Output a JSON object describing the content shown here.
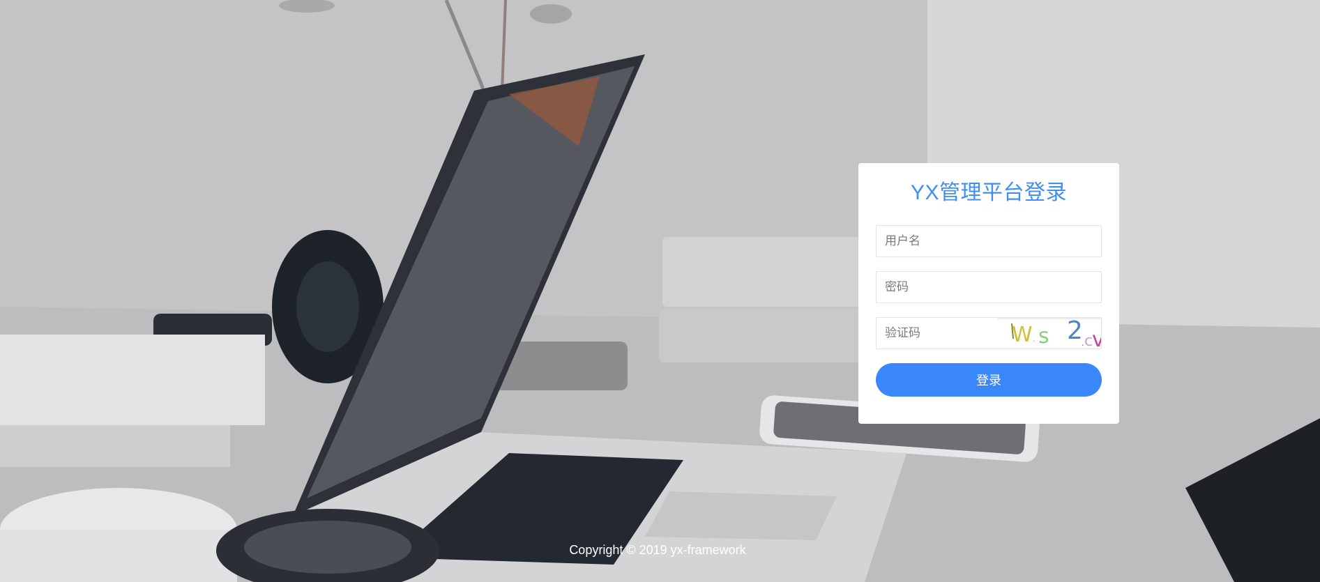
{
  "login": {
    "title": "YX管理平台登录",
    "username_placeholder": "用户名",
    "password_placeholder": "密码",
    "captcha_placeholder": "验证码",
    "captcha_text": "W.s 2.cv",
    "submit_label": "登录"
  },
  "footer": {
    "copyright": "Copyright © 2019 yx-framework"
  },
  "colors": {
    "accent": "#3a86fb",
    "title": "#3f8ef7"
  },
  "background": {
    "icon": "desk-laptop-photo"
  }
}
